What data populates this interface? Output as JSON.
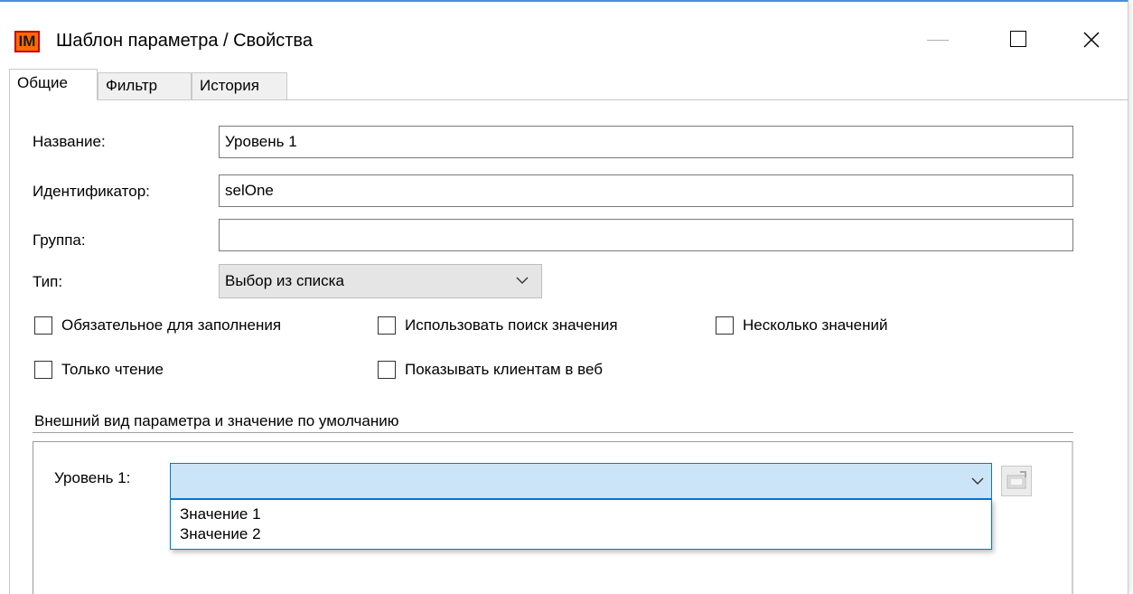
{
  "window": {
    "title": "Шаблон параметра / Свойства",
    "logo_text": "IM",
    "accent_color": "#ff6a00"
  },
  "tabs": [
    {
      "label": "Общие",
      "active": true
    },
    {
      "label": "Фильтр",
      "active": false
    },
    {
      "label": "История",
      "active": false
    }
  ],
  "form": {
    "name_label": "Название:",
    "name_value": "Уровень 1",
    "id_label": "Идентификатор:",
    "id_value": "selOne",
    "group_label": "Группа:",
    "group_value": "",
    "type_label": "Тип:",
    "type_value": "Выбор из списка"
  },
  "checkboxes": [
    {
      "label": "Обязательное для заполнения",
      "checked": false
    },
    {
      "label": "Использовать поиск значения",
      "checked": false
    },
    {
      "label": "Несколько значений",
      "checked": false
    },
    {
      "label": "Только чтение",
      "checked": false
    },
    {
      "label": "Показывать клиентам в веб",
      "checked": false
    }
  ],
  "preview": {
    "group_title": "Внешний вид параметра и значение по умолчанию",
    "field_label": "Уровень 1:",
    "selected_value": "",
    "options": [
      "Значение 1",
      "Значение 2"
    ],
    "edit_icon": "edit-values-icon"
  }
}
